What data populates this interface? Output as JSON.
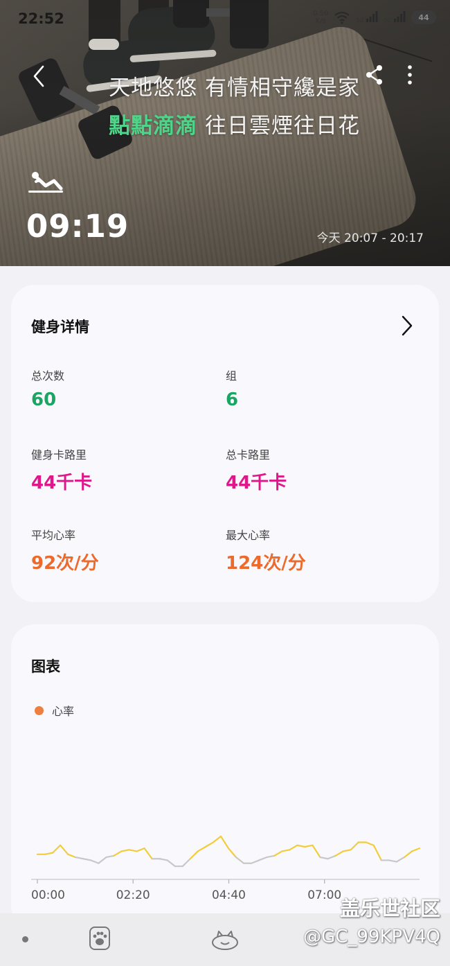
{
  "status_bar": {
    "time": "22:52",
    "net_speed_value": "0.50",
    "net_speed_unit": "K/s",
    "signal_1": "5G",
    "signal_2": "5G",
    "battery": "44"
  },
  "header": {
    "lyrics_line1": "天地悠悠 有情相守纔是家",
    "lyrics_line2_highlight": "點點滴滴",
    "lyrics_line2_rest": " 往日雲煙往日花",
    "duration": "09:19",
    "time_range": "今天 20:07 - 20:17",
    "icons": {
      "back": "chevron-left-icon",
      "share": "share-icon",
      "more": "more-vertical-icon",
      "workout": "situp-workout-icon"
    }
  },
  "details": {
    "title": "健身详情",
    "stats": [
      {
        "label": "总次数",
        "value": "60",
        "color": "#1aa563"
      },
      {
        "label": "组",
        "value": "6",
        "color": "#1aa563"
      },
      {
        "label": "健身卡路里",
        "value": "44千卡",
        "color": "#e0178a"
      },
      {
        "label": "总卡路里",
        "value": "44千卡",
        "color": "#e0178a"
      },
      {
        "label": "平均心率",
        "value": "92次/分",
        "color": "#ec6a2c"
      },
      {
        "label": "最大心率",
        "value": "124次/分",
        "color": "#ec6a2c"
      }
    ]
  },
  "chart": {
    "title": "图表",
    "legend_label": "心率"
  },
  "chart_data": {
    "type": "line",
    "series": [
      {
        "name": "心率",
        "values": [
          86,
          86,
          87,
          92,
          86,
          84,
          83,
          82,
          80,
          84,
          85,
          88,
          89,
          88,
          90,
          83,
          83,
          82,
          78,
          78,
          83,
          88,
          91,
          94,
          98,
          90,
          84,
          80,
          80,
          82,
          84,
          85,
          88,
          89,
          92,
          91,
          92,
          84,
          83,
          85,
          88,
          89,
          94,
          94,
          92,
          82,
          82,
          81,
          84,
          88,
          90
        ]
      }
    ],
    "x_ticks": [
      "00:00",
      "02:20",
      "04:40",
      "07:00"
    ],
    "x_range_seconds": [
      0,
      559
    ],
    "ylim": [
      72,
      110
    ],
    "colors": {
      "high": "#f2cc3a",
      "low": "#c8c8c8",
      "legend": "#ee7f3f"
    }
  },
  "nav": {
    "icons": [
      "dot-icon",
      "paw-icon",
      "cat-icon"
    ]
  },
  "watermark": {
    "title": "盖乐世社区",
    "user": "@GC_99KPV4Q"
  }
}
